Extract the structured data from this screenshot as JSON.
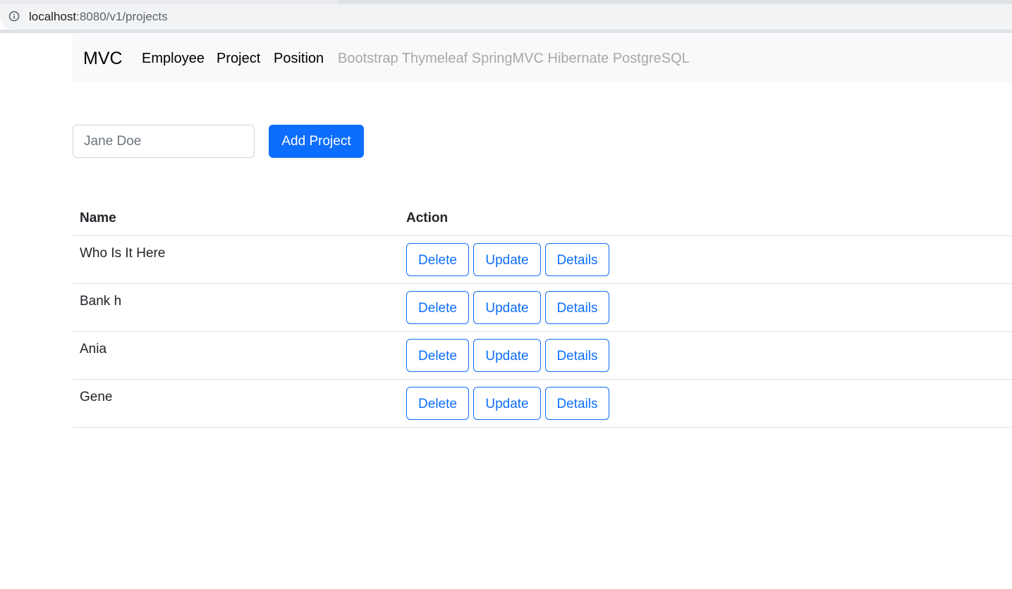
{
  "browser": {
    "url_host": "localhost",
    "url_path": ":8080/v1/projects",
    "info_icon": "info-icon"
  },
  "navbar": {
    "brand": "MVC",
    "links": [
      "Employee",
      "Project",
      "Position"
    ],
    "muted_text": "Bootstrap Thymeleaf SpringMVC Hibernate PostgreSQL"
  },
  "form": {
    "name_placeholder": "Jane Doe",
    "name_value": "",
    "add_label": "Add Project"
  },
  "table": {
    "headers": [
      "Name",
      "Action"
    ],
    "rows": [
      {
        "name": "Who Is It Here",
        "actions": [
          "Delete",
          "Update",
          "Details"
        ]
      },
      {
        "name": "Bank h",
        "actions": [
          "Delete",
          "Update",
          "Details"
        ]
      },
      {
        "name": "Ania",
        "actions": [
          "Delete",
          "Update",
          "Details"
        ]
      },
      {
        "name": "Gene",
        "actions": [
          "Delete",
          "Update",
          "Details"
        ]
      }
    ]
  },
  "colors": {
    "primary": "#0d6efd",
    "navbar_bg": "#f8f9fa",
    "muted_text": "#a6a8aa",
    "border": "#dee2e6"
  }
}
